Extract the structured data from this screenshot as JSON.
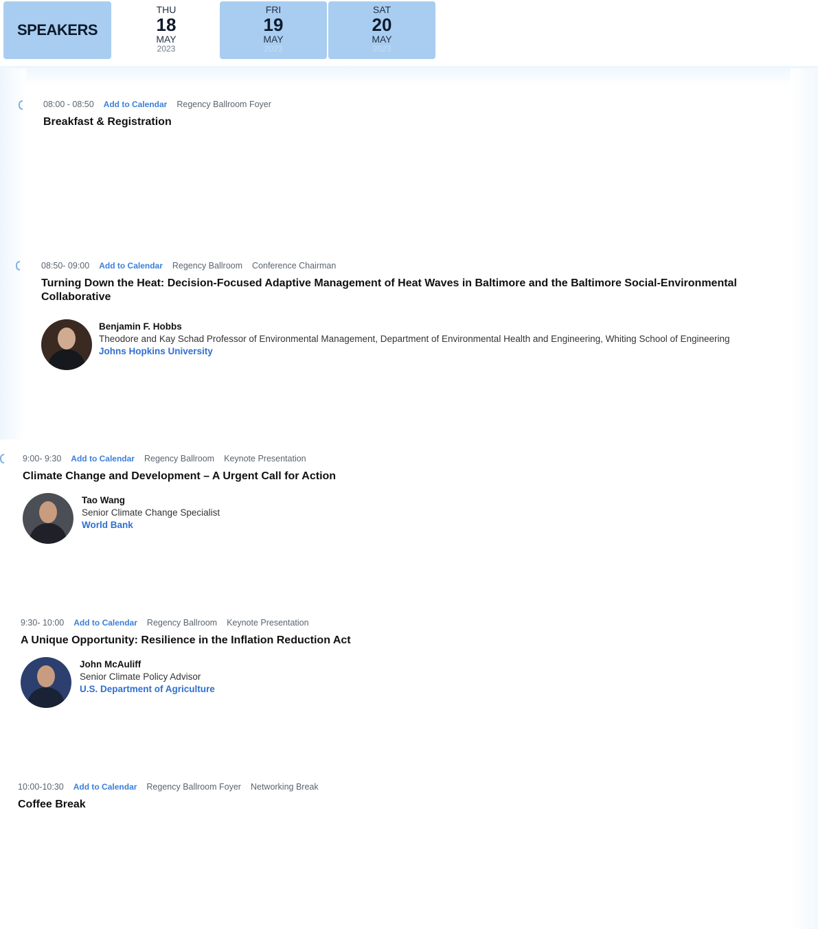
{
  "tabs": {
    "speakers_label": "SPEAKERS",
    "days": [
      {
        "dow": "THU",
        "num": "18",
        "month": "MAY",
        "year": "2023"
      },
      {
        "dow": "FRI",
        "num": "19",
        "month": "MAY",
        "year": "2023"
      },
      {
        "dow": "SAT",
        "num": "20",
        "month": "MAY",
        "year": "2023"
      }
    ]
  },
  "sessions": [
    {
      "time": "08:00 - 08:50",
      "calendar": "Add to Calendar",
      "room": "Regency Ballroom Foyer",
      "type": "",
      "title": "Breakfast & Registration"
    },
    {
      "time": "08:50- 09:00",
      "calendar": "Add to Calendar",
      "room": "Regency Ballroom",
      "type": "Conference Chairman",
      "title": "Turning Down the Heat: Decision-Focused Adaptive Management of Heat Waves in Baltimore and the Baltimore Social-Environmental Collaborative",
      "speaker": {
        "name": "Benjamin F. Hobbs",
        "title": "Theodore and Kay Schad Professor of Environmental Management, Department of Environmental Health and Engineering, Whiting School of Engineering",
        "org": "Johns Hopkins University"
      }
    },
    {
      "time": "9:00- 9:30",
      "calendar": "Add to Calendar",
      "room": "Regency Ballroom",
      "type": "Keynote Presentation",
      "title": "Climate Change and Development – A Urgent Call for Action",
      "speaker": {
        "name": "Tao Wang",
        "title": "Senior Climate Change Specialist",
        "org": "World Bank"
      }
    },
    {
      "time": "9:30- 10:00",
      "calendar": "Add to Calendar",
      "room": "Regency Ballroom",
      "type": "Keynote Presentation",
      "title": "A Unique Opportunity: Resilience in the Inflation Reduction Act",
      "speaker": {
        "name": "John McAuliff",
        "title": "Senior Climate Policy Advisor",
        "org": "U.S. Department of Agriculture"
      }
    },
    {
      "time": "10:00-10:30",
      "calendar": "Add to Calendar",
      "room": "Regency Ballroom Foyer",
      "type": "Networking Break",
      "title": "Coffee Break"
    }
  ]
}
